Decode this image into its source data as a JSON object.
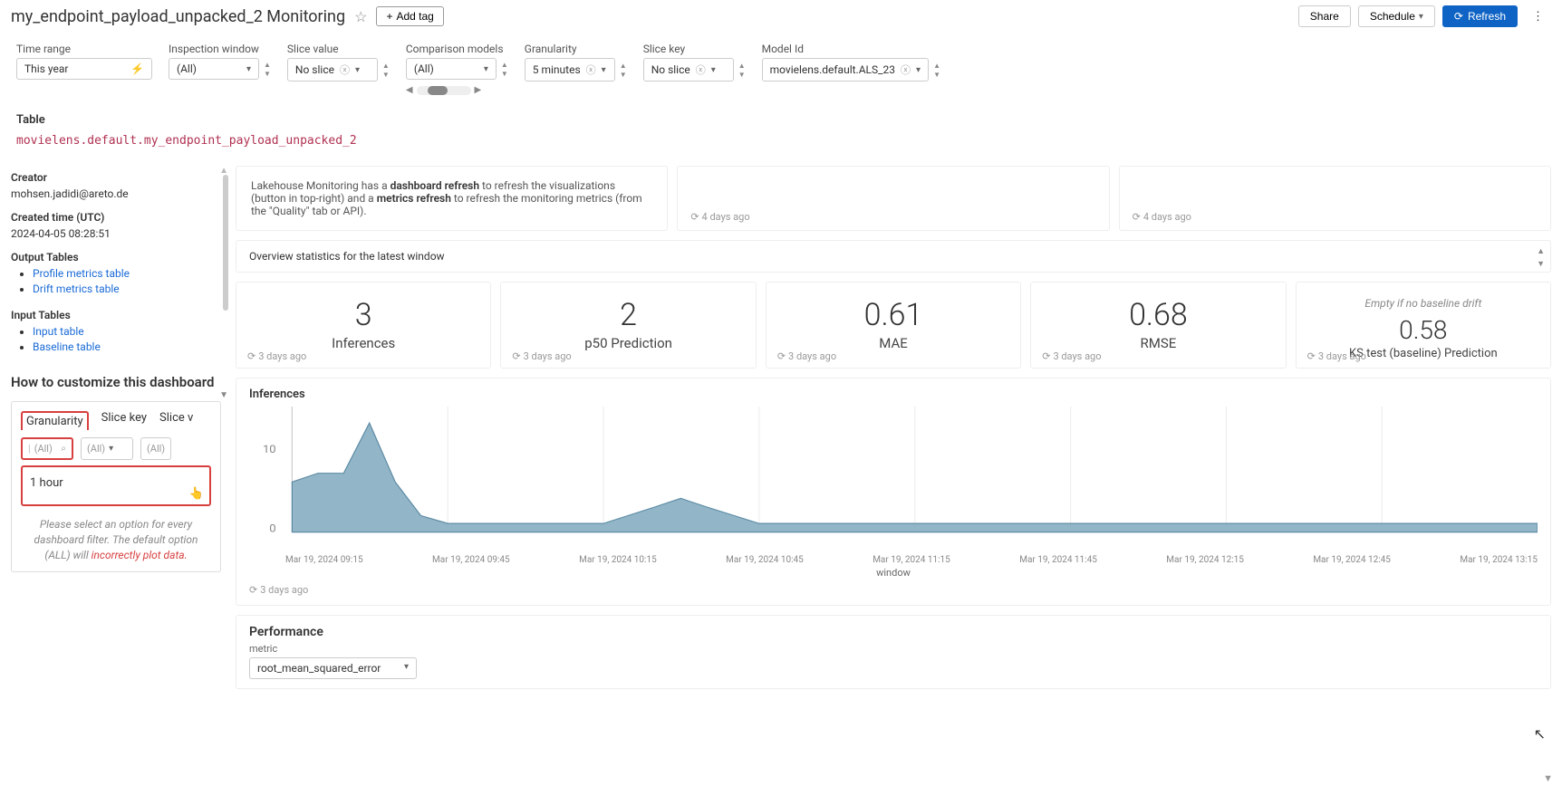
{
  "header": {
    "title": "my_endpoint_payload_unpacked_2 Monitoring",
    "add_tag": "Add tag",
    "share": "Share",
    "schedule": "Schedule",
    "refresh": "Refresh"
  },
  "filters": {
    "time_range": {
      "label": "Time range",
      "value": "This year"
    },
    "inspection_window": {
      "label": "Inspection window",
      "value": "(All)"
    },
    "slice_value": {
      "label": "Slice value",
      "value": "No slice"
    },
    "comparison_models": {
      "label": "Comparison models",
      "value": "(All)"
    },
    "granularity": {
      "label": "Granularity",
      "value": "5 minutes"
    },
    "slice_key": {
      "label": "Slice key",
      "value": "No slice"
    },
    "model_id": {
      "label": "Model Id",
      "value": "movielens.default.ALS_23"
    }
  },
  "table": {
    "label": "Table",
    "value": "movielens.default.my_endpoint_payload_unpacked_2"
  },
  "sidebar": {
    "creator_label": "Creator",
    "creator_value": "mohsen.jadidi@areto.de",
    "created_label": "Created time (UTC)",
    "created_value": "2024-04-05 08:28:51",
    "output_label": "Output Tables",
    "output_links": [
      "Profile metrics table",
      "Drift metrics table"
    ],
    "input_label": "Input Tables",
    "input_links": [
      "Input table",
      "Baseline table"
    ],
    "customize_label": "How to customize this dashboard",
    "filter_tabs": [
      "Granularity",
      "Slice key",
      "Slice v"
    ],
    "filter_placeholder": "(All)",
    "filter_option": "1 hour",
    "note_pre": "Please select an option for every dashboard filter. The default option ",
    "note_all": "(ALL)",
    "note_will": " will ",
    "note_err": "incorrectly plot data."
  },
  "info": {
    "text_pre": "Lakehouse Monitoring has a ",
    "b1": "dashboard refresh",
    "text_mid": " to refresh the visualizations (button in top-right) and a ",
    "b2": "metrics refresh",
    "text_post": " to refresh the monitoring metrics (from the \"Quality\" tab or API).",
    "ts1": "4 days ago",
    "ts2": "4 days ago"
  },
  "overview_label": "Overview statistics for the latest window",
  "stats": [
    {
      "value": "3",
      "label": "Inferences",
      "ts": "3 days ago"
    },
    {
      "value": "2",
      "label": "p50 Prediction",
      "ts": "3 days ago"
    },
    {
      "value": "0.61",
      "label": "MAE",
      "ts": "3 days ago"
    },
    {
      "value": "0.68",
      "label": "RMSE",
      "ts": "3 days ago"
    },
    {
      "note": "Empty if no baseline drift",
      "value": "0.58",
      "label": "KS test (baseline) Prediction",
      "ts": "3 days ago"
    }
  ],
  "chart": {
    "title": "Inferences",
    "ts": "3 days ago",
    "y_ticks": [
      "10",
      "0"
    ],
    "x_ticks": [
      "Mar 19, 2024 09:15",
      "Mar 19, 2024 09:45",
      "Mar 19, 2024 10:15",
      "Mar 19, 2024 10:45",
      "Mar 19, 2024 11:15",
      "Mar 19, 2024 11:45",
      "Mar 19, 2024 12:15",
      "Mar 19, 2024 12:45",
      "Mar 19, 2024 13:15"
    ],
    "x_label": "window"
  },
  "chart_data": {
    "type": "area",
    "title": "Inferences",
    "xlabel": "window",
    "ylabel": "",
    "ylim": [
      0,
      14
    ],
    "x": [
      "Mar 19, 2024 09:15",
      "Mar 19, 2024 09:20",
      "Mar 19, 2024 09:25",
      "Mar 19, 2024 09:30",
      "Mar 19, 2024 09:35",
      "Mar 19, 2024 09:40",
      "Mar 19, 2024 09:45",
      "Mar 19, 2024 09:50",
      "Mar 19, 2024 10:15",
      "Mar 19, 2024 10:25",
      "Mar 19, 2024 10:30",
      "Mar 19, 2024 10:35",
      "Mar 19, 2024 10:45",
      "Mar 19, 2024 11:00",
      "Mar 19, 2024 13:30"
    ],
    "values": [
      6,
      7,
      7,
      13,
      6,
      2,
      1,
      1,
      1,
      3,
      4,
      3,
      1,
      1,
      1
    ]
  },
  "performance": {
    "title": "Performance",
    "metric_label": "metric",
    "metric_value": "root_mean_squared_error"
  }
}
